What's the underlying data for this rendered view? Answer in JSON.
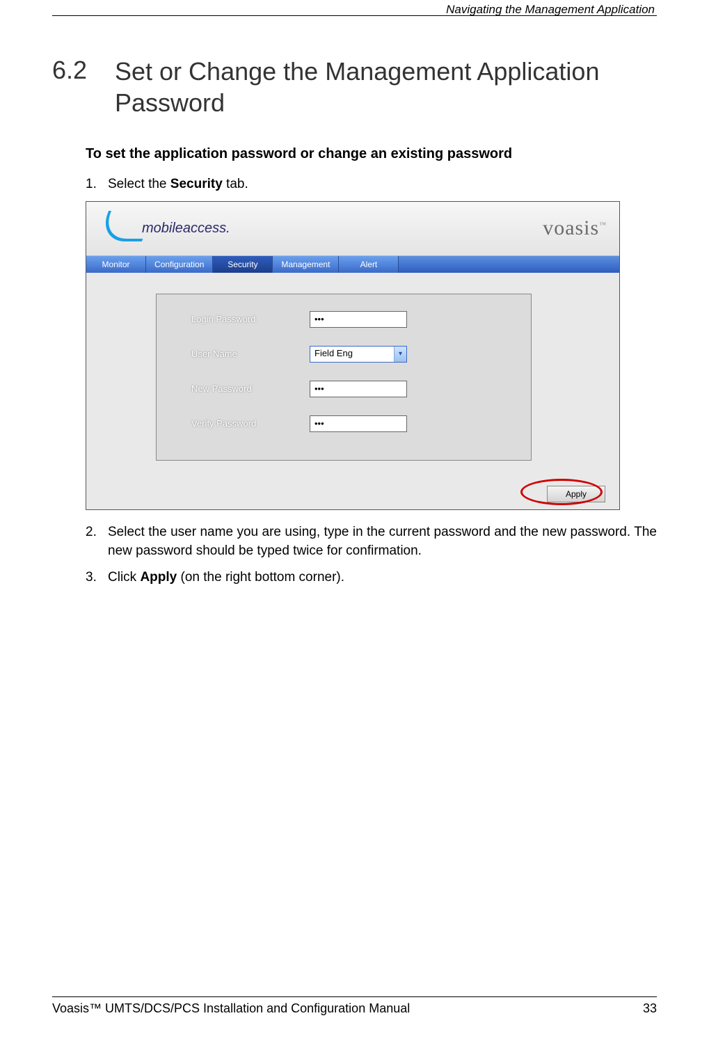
{
  "header": {
    "running_title": "Navigating the Management Application"
  },
  "section": {
    "number": "6.2",
    "title": "Set or Change the Management Application Password"
  },
  "subhead": "To set the application password or change an existing password",
  "steps": {
    "s1_num": "1.",
    "s1_pre": "Select the ",
    "s1_bold": "Security",
    "s1_post": " tab.",
    "s2_num": "2.",
    "s2_text": "Select the user name you are using, type in the current password and the new password. The new password should be typed twice for confirmation.",
    "s3_num": "3.",
    "s3_pre": "Click ",
    "s3_bold": "Apply",
    "s3_post": " (on the right bottom corner)."
  },
  "app": {
    "logo_left": "mobileaccess.",
    "logo_right": "voasis",
    "logo_right_tm": "™",
    "tabs": [
      "Monitor",
      "Configuration",
      "Security",
      "Management",
      "Alert"
    ],
    "form": {
      "login_password": {
        "label": "Login Password",
        "value": "•••"
      },
      "user_name": {
        "label": "User Name",
        "value": "Field Eng"
      },
      "new_password": {
        "label": "New Password",
        "value": "•••"
      },
      "verify_password": {
        "label": "Verify Password",
        "value": "•••"
      }
    },
    "apply_label": "Apply"
  },
  "footer": {
    "left": "Voasis™ UMTS/DCS/PCS Installation and Configuration Manual",
    "right": "33"
  }
}
